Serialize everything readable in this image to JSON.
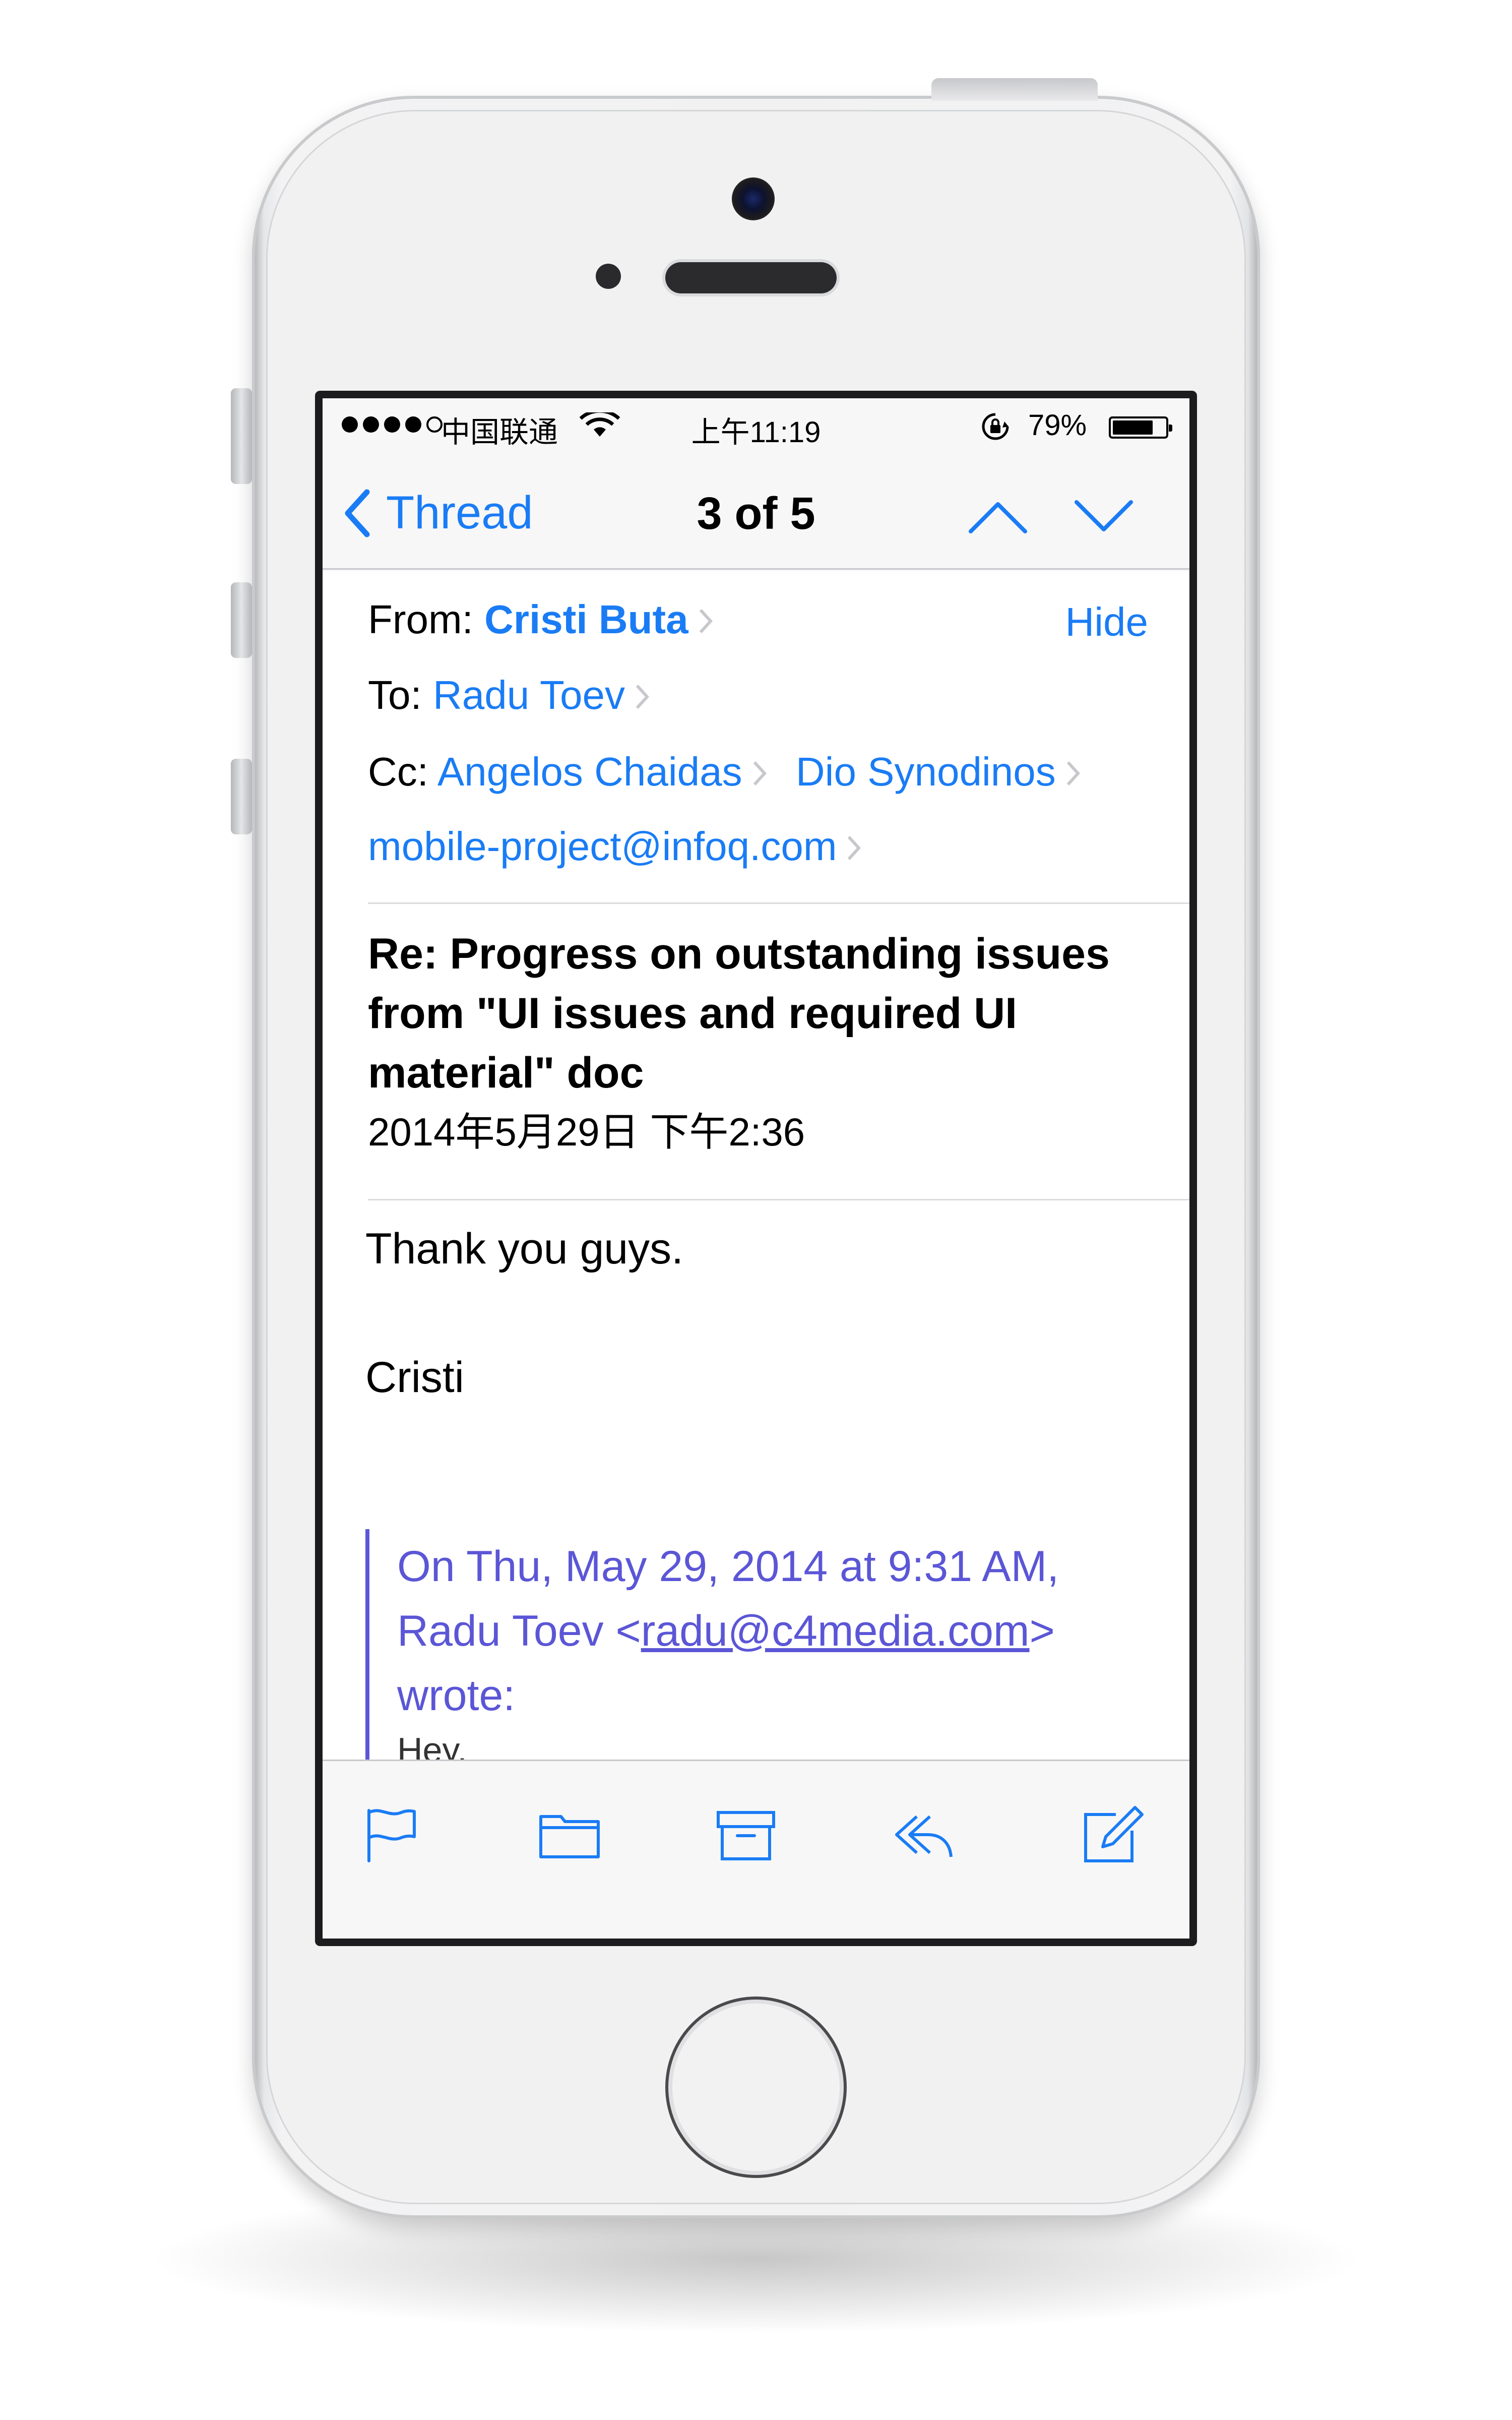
{
  "status_bar": {
    "carrier": "中国联通",
    "time": "上午11:19",
    "battery_percent": "79%",
    "battery_level": 0.79,
    "signal_bars": 4
  },
  "nav": {
    "back_label": "Thread",
    "title": "3 of 5"
  },
  "message": {
    "from_label": "From:",
    "from_name": "Cristi Buta",
    "hide_label": "Hide",
    "to_label": "To:",
    "to_name": "Radu Toev",
    "cc_label": "Cc:",
    "cc_names": [
      "Angelos Chaidas",
      "Dio Synodinos"
    ],
    "cc_email": "mobile-project@infoq.com",
    "subject": "Re: Progress on outstanding issues from \"UI issues and required UI material\" doc",
    "date": "2014年5月29日 下午2:36",
    "body_lines": [
      "Thank you guys.",
      "Cristi"
    ],
    "quote": {
      "intro": "On Thu, May 29, 2014 at 9:31 AM, Radu Toev <",
      "email": "radu@c4media.com",
      "outro": "> wrote:",
      "first_line": "Hey,"
    }
  },
  "toolbar": {
    "icons": [
      "flag-icon",
      "folder-icon",
      "archive-icon",
      "reply-icon",
      "compose-icon"
    ]
  },
  "colors": {
    "accent": "#1a7cf5",
    "quote": "#5b56d6"
  }
}
